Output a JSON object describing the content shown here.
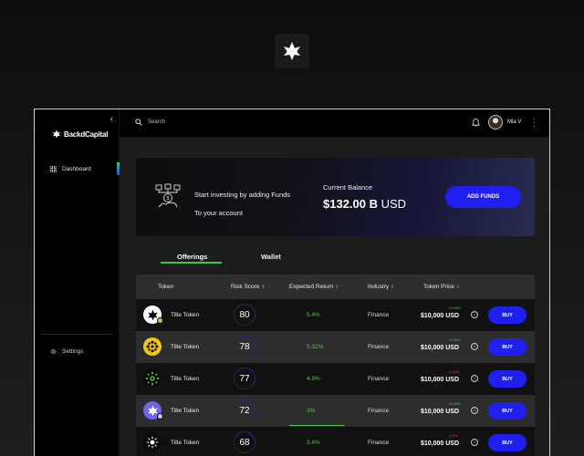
{
  "app": {
    "brand": "BackdCapital",
    "colors": {
      "accent": "#1f1ff0",
      "positive": "#53c64a",
      "negative": "#e24a4a",
      "tab_underline": "#3fc64b"
    }
  },
  "sidebar": {
    "collapse_icon": "chevron-left-icon",
    "items": [
      {
        "label": "Dashboard",
        "icon": "grid-icon"
      },
      {
        "label": "Settings",
        "icon": "gear-icon"
      }
    ]
  },
  "topbar": {
    "search_placeholder": "Search",
    "user_name": "Mia V"
  },
  "banner": {
    "line1": "Start investing by adding Funds",
    "line2": "To your account",
    "balance_label": "Current Balance",
    "balance_amount": "$132.00 B",
    "balance_currency": "USD",
    "add_funds_label": "ADD FUNDS"
  },
  "tabs": [
    {
      "label": "Offerings",
      "active": true
    },
    {
      "label": "Wallet",
      "active": false
    }
  ],
  "table": {
    "columns": [
      "Token",
      "Risk Score",
      "Expected Return",
      "Industry",
      "Token Price"
    ],
    "rows": [
      {
        "name": "Title Token",
        "icon": "white-star-token-icon",
        "risk": "80",
        "expected_return": "5.4%",
        "industry": "Finance",
        "change": "+0.26%",
        "change_dir": "up",
        "price": "$10,000 USD",
        "buy": "BUY"
      },
      {
        "name": "Title Token",
        "icon": "yellow-flower-token-icon",
        "risk": "78",
        "expected_return": "5.32%",
        "industry": "Finance",
        "change": "+0.26%",
        "change_dir": "up",
        "price": "$10,000 USD",
        "buy": "BUY"
      },
      {
        "name": "Title Token",
        "icon": "green-sun-token-icon",
        "risk": "77",
        "expected_return": "4.9%",
        "industry": "Finance",
        "change": "-0.13%",
        "change_dir": "down",
        "price": "$10,000 USD",
        "buy": "BUY"
      },
      {
        "name": "Title Token",
        "icon": "purple-star-token-icon",
        "risk": "72",
        "expected_return": "3%",
        "industry": "Finance",
        "change": "+0.26%",
        "change_dir": "up",
        "price": "$10,000 USD",
        "buy": "BUY"
      },
      {
        "name": "Title Token",
        "icon": "white-burst-token-icon",
        "risk": "68",
        "expected_return": "3.4%",
        "industry": "Finance",
        "change": "-0.2%",
        "change_dir": "down",
        "price": "$10,000 USD",
        "buy": "BUY"
      }
    ]
  }
}
